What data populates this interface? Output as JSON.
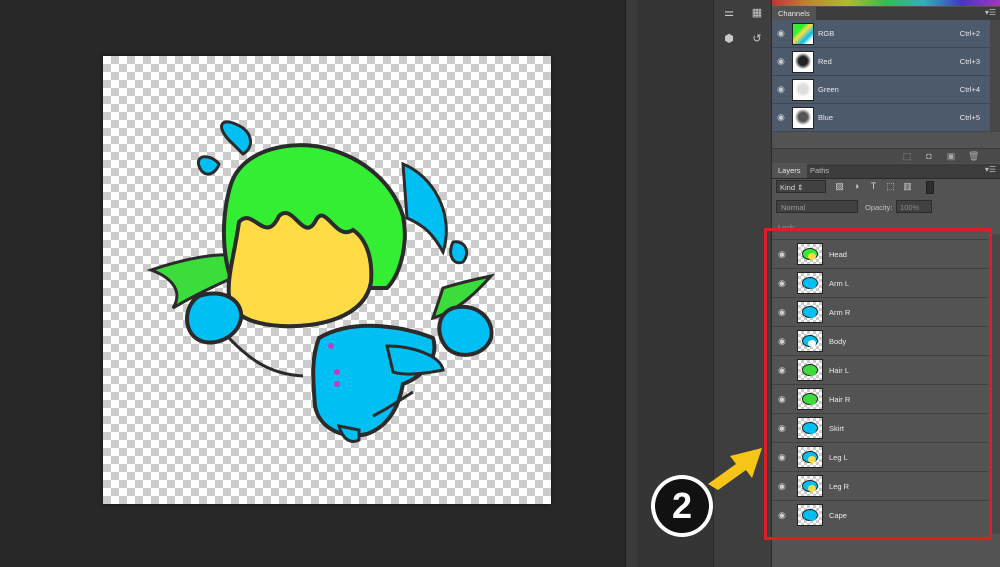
{
  "channels_panel": {
    "tab": "Channels",
    "rows": [
      {
        "name": "RGB",
        "shortcut": "Ctrl+2"
      },
      {
        "name": "Red",
        "shortcut": "Ctrl+3"
      },
      {
        "name": "Green",
        "shortcut": "Ctrl+4"
      },
      {
        "name": "Blue",
        "shortcut": "Ctrl+5"
      }
    ]
  },
  "layers_panel": {
    "tabs": [
      "Layers",
      "Paths"
    ],
    "filter_kind": "Kind",
    "blend_mode": "Normal",
    "opacity_label": "Opacity:",
    "opacity_value": "100%",
    "lock_label": "Lock:",
    "layers": [
      "Head",
      "Arm L",
      "Arm R",
      "Body",
      "Hair L",
      "Hair R",
      "Skirt",
      "Leg L",
      "Leg R",
      "Cape"
    ]
  },
  "annotation": {
    "step_number": "2",
    "highlight_color": "#e01d22",
    "arrow_color": "#f5c518"
  },
  "icons": [
    "eye-icon",
    "filter-image-icon",
    "filter-adjustment-icon",
    "filter-type-icon",
    "filter-shape-icon",
    "filter-smart-icon"
  ]
}
